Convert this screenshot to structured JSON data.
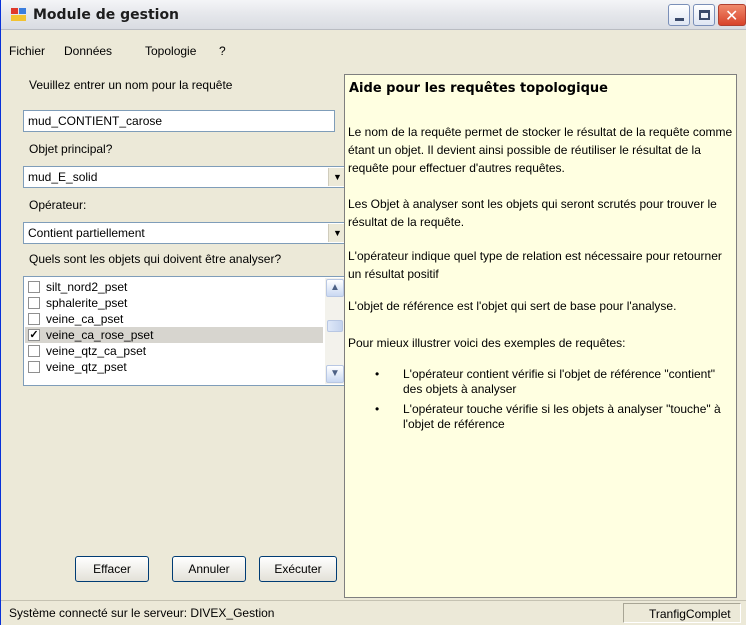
{
  "window": {
    "title": "Module de gestion"
  },
  "menu": [
    "Fichier",
    "Données",
    "Topologie",
    "?"
  ],
  "form": {
    "name_label": "Veuillez entrer un nom pour la requête",
    "name_value": "mud_CONTIENT_carose",
    "main_object_label": "Objet principal?",
    "main_object_value": "mud_E_solid",
    "operator_label": "Opérateur:",
    "operator_value": "Contient partiellement",
    "objects_label": "Quels sont les objets qui doivent être analyser?",
    "objects": [
      {
        "label": "silt_nord2_pset",
        "checked": false
      },
      {
        "label": "sphalerite_pset",
        "checked": false
      },
      {
        "label": "veine_ca_pset",
        "checked": false
      },
      {
        "label": "veine_ca_rose_pset",
        "checked": true
      },
      {
        "label": "veine_qtz_ca_pset",
        "checked": false
      },
      {
        "label": "veine_qtz_pset",
        "checked": false
      }
    ],
    "buttons": {
      "clear": "Effacer",
      "cancel": "Annuler",
      "execute": "Exécuter"
    }
  },
  "help": {
    "title": "Aide pour les requêtes topologique",
    "p1": "Le nom de la requête permet de stocker le résultat de la requête comme étant un objet. Il devient ainsi possible de réutiliser le résultat de la requête pour effectuer d'autres requêtes.",
    "p2": "Les Objet à analyser sont les objets qui seront scrutés pour trouver le résultat de la requête.",
    "p3": "L'opérateur indique quel type de relation est nécessaire pour retourner un résultat positif",
    "p4": "L'objet de référence est l'objet qui sert de base pour l'analyse.",
    "p5": "Pour mieux illustrer voici des exemples de requêtes:",
    "bullets": [
      "L'opérateur contient vérifie si l'objet de référence \"contient\" des objets à analyser",
      "L'opérateur touche vérifie si les objets à analyser \"touche\" à l'objet de référence"
    ]
  },
  "status": {
    "left": "Système connecté sur le serveur: DIVEX_Gestion",
    "right": "TranfigComplet"
  },
  "icons": {
    "minimize": "minimize-icon",
    "maximize": "maximize-icon",
    "close": "close-icon",
    "dropdown": "chevron-down-icon",
    "check": "checkmark-icon"
  },
  "colors": {
    "window_bg": "#ece9d8",
    "help_bg": "#ffffe1",
    "close_button": "#d8432a"
  }
}
